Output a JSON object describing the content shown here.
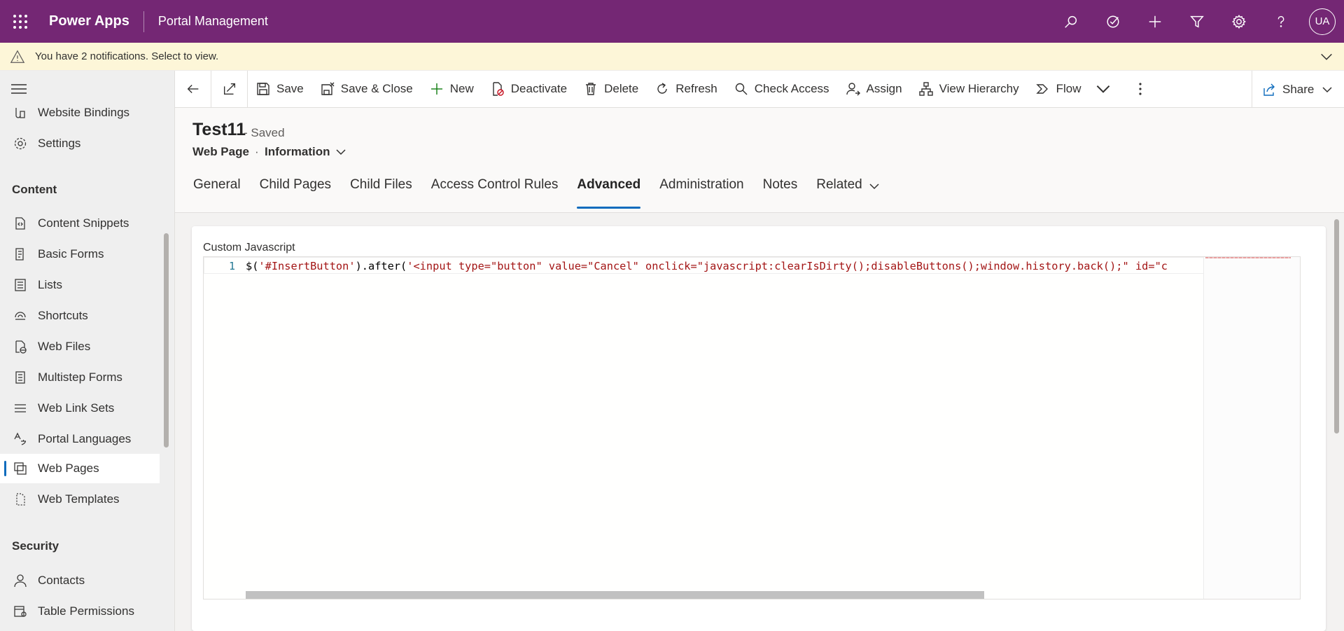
{
  "appbar": {
    "app_name": "Power Apps",
    "environment": "Portal Management",
    "avatar_initials": "UA",
    "color": "#742774"
  },
  "notification": {
    "text": "You have 2 notifications. Select to view."
  },
  "leftnav": {
    "items_top": [
      {
        "label": "Website Bindings",
        "icon": "website-bindings-icon"
      },
      {
        "label": "Settings",
        "icon": "gear-icon"
      }
    ],
    "section_content": "Content",
    "items_content": [
      {
        "label": "Content Snippets",
        "icon": "snippet-icon"
      },
      {
        "label": "Basic Forms",
        "icon": "form-icon"
      },
      {
        "label": "Lists",
        "icon": "list-icon"
      },
      {
        "label": "Shortcuts",
        "icon": "shortcut-icon"
      },
      {
        "label": "Web Files",
        "icon": "web-file-icon"
      },
      {
        "label": "Multistep Forms",
        "icon": "multistep-form-icon"
      },
      {
        "label": "Web Link Sets",
        "icon": "link-set-icon"
      },
      {
        "label": "Portal Languages",
        "icon": "language-icon"
      },
      {
        "label": "Web Pages",
        "icon": "web-pages-icon",
        "selected": true
      },
      {
        "label": "Web Templates",
        "icon": "template-icon"
      }
    ],
    "section_security": "Security",
    "items_security": [
      {
        "label": "Contacts",
        "icon": "contact-icon"
      },
      {
        "label": "Table Permissions",
        "icon": "permission-icon"
      }
    ]
  },
  "commandbar": {
    "save": "Save",
    "save_close": "Save & Close",
    "new": "New",
    "deactivate": "Deactivate",
    "delete": "Delete",
    "refresh": "Refresh",
    "check_access": "Check Access",
    "assign": "Assign",
    "view_hierarchy": "View Hierarchy",
    "flow": "Flow",
    "share": "Share"
  },
  "record": {
    "title": "Test11",
    "status": "- Saved",
    "entity": "Web Page",
    "separator": "·",
    "form": "Information"
  },
  "tabs": [
    {
      "label": "General"
    },
    {
      "label": "Child Pages"
    },
    {
      "label": "Child Files"
    },
    {
      "label": "Access Control Rules"
    },
    {
      "label": "Advanced",
      "active": true
    },
    {
      "label": "Administration"
    },
    {
      "label": "Notes"
    },
    {
      "label": "Related"
    }
  ],
  "editor": {
    "label": "Custom Javascript",
    "line_number": "1",
    "code_prefix": "$(",
    "code_selector": "'#InsertButton'",
    "code_method": ").after(",
    "code_string": "'<input type=\"button\" value=\"Cancel\" onclick=\"javascript:clearIsDirty();disableButtons();window.history.back();\" id=\"c",
    "string_color": "#a31515"
  }
}
